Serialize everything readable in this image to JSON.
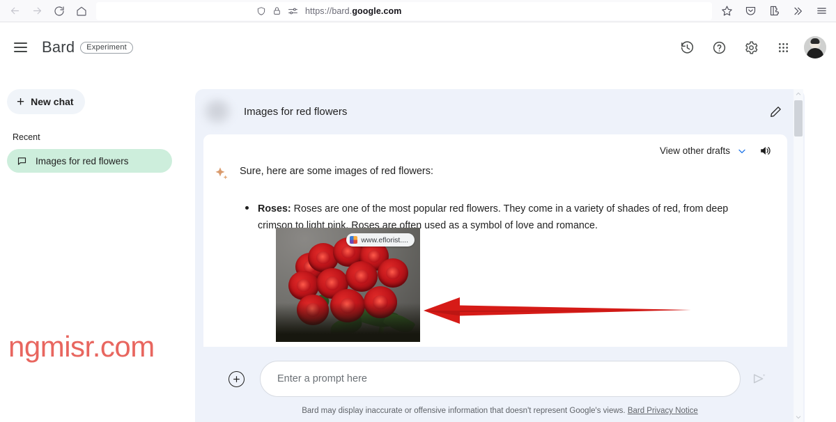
{
  "browser": {
    "back_icon": "back-arrow-icon",
    "forward_icon": "forward-arrow-icon",
    "reload_icon": "reload-icon",
    "home_icon": "home-icon",
    "url_prefix": "https://bard.",
    "url_domain": "google.com",
    "full_url": "https://bard.google.com",
    "shield_icon": "shield-icon",
    "lock_icon": "lock-icon",
    "permissions_icon": "permissions-icon",
    "bookmark_icon": "star-icon",
    "pocket_icon": "pocket-icon",
    "extensions_icon": "extensions-icon",
    "overflow_icon": "chevron-double-right-icon",
    "menu_icon": "hamburger-menu-icon"
  },
  "header": {
    "menu_label": "Main menu",
    "product_name": "Bard",
    "badge": "Experiment",
    "history_icon": "history-icon",
    "help_icon": "help-icon",
    "settings_icon": "gear-icon",
    "apps_icon": "apps-grid-icon",
    "avatar_label": "Account"
  },
  "sidebar": {
    "new_chat_label": "New chat",
    "recent_label": "Recent",
    "items": [
      {
        "label": "Images for red flowers",
        "icon": "chat-bubble-icon",
        "selected": true
      }
    ]
  },
  "watermark": "ngmisr.com",
  "conversation": {
    "prompt_title": "Images for red flowers",
    "edit_icon": "pencil-icon",
    "drafts_label": "View other drafts",
    "drafts_chevron": "chevron-down-icon",
    "speaker_icon": "speaker-icon",
    "sparkle_icon": "bard-sparkle-icon",
    "intro_text": "Sure, here are some images of red flowers:",
    "bullets": [
      {
        "term": "Roses:",
        "text": " Roses are one of the most popular red flowers. They come in a variety of shades of red, from deep crimson to light pink. Roses are often used as a symbol of love and romance."
      }
    ],
    "image": {
      "alt": "Bouquet of red roses",
      "attribution": "www.eflorist....",
      "favicon": "site-favicon-icon"
    }
  },
  "annotation": {
    "arrow": "red-arrow-pointing-left",
    "color": "#d61b17"
  },
  "composer": {
    "add_icon": "plus-circle-icon",
    "placeholder": "Enter a prompt here",
    "value": "",
    "send_icon": "send-icon",
    "disclaimer_text": "Bard may display inaccurate or offensive information that doesn't represent Google's views.",
    "privacy_link": "Bard Privacy Notice"
  },
  "scrollbar": {
    "up_icon": "scroll-up-icon",
    "down_icon": "scroll-down-icon",
    "thumb_label": "scroll-thumb"
  },
  "colors": {
    "accent_green": "#cdeedc",
    "panel_bg": "#eef2fa",
    "annotation_red": "#d61b17",
    "watermark_red": "#e8665f"
  }
}
